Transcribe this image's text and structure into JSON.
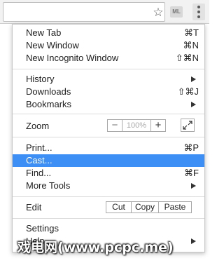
{
  "toolbar": {
    "extension_label": "ML"
  },
  "menu": {
    "new_tab": {
      "label": "New Tab",
      "shortcut": "⌘T"
    },
    "new_window": {
      "label": "New Window",
      "shortcut": "⌘N"
    },
    "new_incognito": {
      "label": "New Incognito Window",
      "shortcut": "⇧⌘N"
    },
    "history": {
      "label": "History"
    },
    "downloads": {
      "label": "Downloads",
      "shortcut": "⇧⌘J"
    },
    "bookmarks": {
      "label": "Bookmarks"
    },
    "zoom": {
      "label": "Zoom",
      "minus": "−",
      "value": "100%",
      "plus": "+"
    },
    "print": {
      "label": "Print...",
      "shortcut": "⌘P"
    },
    "cast": {
      "label": "Cast..."
    },
    "find": {
      "label": "Find...",
      "shortcut": "⌘F"
    },
    "more_tools": {
      "label": "More Tools"
    },
    "edit": {
      "label": "Edit",
      "cut": "Cut",
      "copy": "Copy",
      "paste": "Paste"
    },
    "settings": {
      "label": "Settings"
    },
    "help": {
      "label": "Help"
    }
  },
  "colors": {
    "highlight": "#3d8ef5"
  },
  "watermark": "戏电网(www.pcpc.me)"
}
